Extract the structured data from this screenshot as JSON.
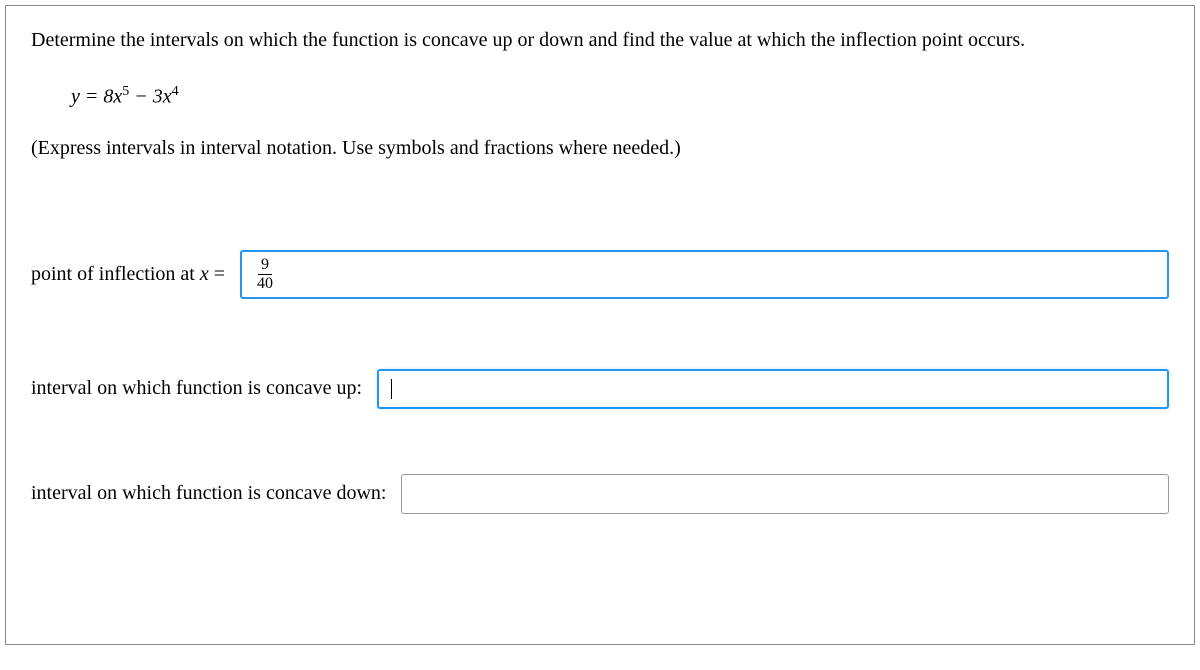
{
  "question": "Determine the intervals on which the function is concave up or down and find the value at which the inflection point occurs.",
  "formula": {
    "y": "y",
    "eq": " = ",
    "coef1": "8",
    "var1": "x",
    "exp1": "5",
    "minus": " − ",
    "coef2": "3",
    "var2": "x",
    "exp2": "4"
  },
  "instruction": "(Express intervals in interval notation. Use symbols and fractions where needed.)",
  "labels": {
    "inflection_prefix": "point of inflection at ",
    "inflection_var": "x",
    "inflection_suffix": " =",
    "concave_up": "interval on which function is concave up:",
    "concave_down": "interval on which function is concave down:"
  },
  "answers": {
    "inflection_num": "9",
    "inflection_den": "40",
    "concave_up": "",
    "concave_down": ""
  }
}
